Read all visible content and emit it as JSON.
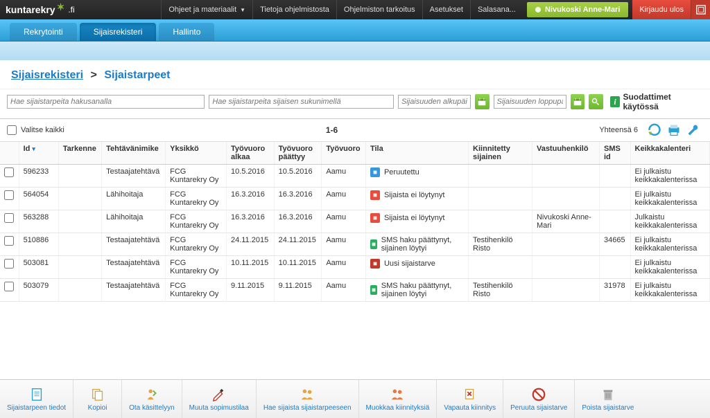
{
  "brand": {
    "name": "kuntarekry",
    "suffix": ".fi"
  },
  "topmenu": {
    "ohjeet": "Ohjeet ja materiaalit",
    "tietoja": "Tietoja ohjelmistosta",
    "tarkoitus": "Ohjelmiston tarkoitus",
    "asetukset": "Asetukset",
    "salasana": "Salasana..."
  },
  "user": {
    "name": "Nivukoski Anne-Mari"
  },
  "logout": "Kirjaudu ulos",
  "tabs": {
    "rekry": "Rekrytointi",
    "sijais": "Sijaisrekisteri",
    "hallinto": "Hallinto"
  },
  "breadcrumb": {
    "root": "Sijaisrekisteri",
    "sep": ">",
    "current": "Sijaistarpeet"
  },
  "search": {
    "ph1": "Hae sijaistarpeita hakusanalla",
    "ph2": "Hae sijaistarpeita sijaisen sukunimellä",
    "ph3": "Sijaisuuden alkupäivä",
    "ph4": "Sijaisuuden loppupäivä",
    "filters_label": "Suodattimet käytössä"
  },
  "listbar": {
    "select_all": "Valitse kaikki",
    "pager": "1-6",
    "total_label": "Yhteensä 6"
  },
  "columns": {
    "id": "Id",
    "tarkenne": "Tarkenne",
    "tehtavanimike": "Tehtävänimike",
    "yksikko": "Yksikkö",
    "alkaa": "Työvuoro alkaa",
    "paattyy": "Työvuoro päättyy",
    "tyovuoro": "Työvuoro",
    "tila": "Tila",
    "kiinnitetty": "Kiinnitetty sijainen",
    "vastuu": "Vastuuhenkilö",
    "smsid": "SMS id",
    "keikka": "Keikkakalenteri"
  },
  "rows": [
    {
      "id": "596233",
      "tarkenne": "",
      "tehtava": "Testaajatehtävä",
      "yksikko": "FCG Kuntarekry Oy",
      "alkaa": "10.5.2016",
      "paattyy": "10.5.2016",
      "vuoro": "Aamu",
      "tila_color": "blue",
      "tila": "Peruutettu",
      "kii": "",
      "vastuu": "",
      "sms": "",
      "keikka": "Ei julkaistu keikkakalenterissa"
    },
    {
      "id": "564054",
      "tarkenne": "",
      "tehtava": "Lähihoitaja",
      "yksikko": "FCG Kuntarekry Oy",
      "alkaa": "16.3.2016",
      "paattyy": "16.3.2016",
      "vuoro": "Aamu",
      "tila_color": "red",
      "tila": "Sijaista ei löytynyt",
      "kii": "",
      "vastuu": "",
      "sms": "",
      "keikka": "Ei julkaistu keikkakalenterissa"
    },
    {
      "id": "563288",
      "tarkenne": "",
      "tehtava": "Lähihoitaja",
      "yksikko": "FCG Kuntarekry Oy",
      "alkaa": "16.3.2016",
      "paattyy": "16.3.2016",
      "vuoro": "Aamu",
      "tila_color": "red",
      "tila": "Sijaista ei löytynyt",
      "kii": "",
      "vastuu": "Nivukoski Anne-Mari",
      "sms": "",
      "keikka": "Julkaistu keikkakalenterissa"
    },
    {
      "id": "510886",
      "tarkenne": "",
      "tehtava": "Testaajatehtävä",
      "yksikko": "FCG Kuntarekry Oy",
      "alkaa": "24.11.2015",
      "paattyy": "24.11.2015",
      "vuoro": "Aamu",
      "tila_color": "green",
      "tila": "SMS haku päättynyt, sijainen löytyi",
      "kii": "Testihenkilö Risto",
      "vastuu": "",
      "sms": "34665",
      "keikka": "Ei julkaistu keikkakalenterissa"
    },
    {
      "id": "503081",
      "tarkenne": "",
      "tehtava": "Testaajatehtävä",
      "yksikko": "FCG Kuntarekry Oy",
      "alkaa": "10.11.2015",
      "paattyy": "10.11.2015",
      "vuoro": "Aamu",
      "tila_color": "redd",
      "tila": "Uusi sijaistarve",
      "kii": "",
      "vastuu": "",
      "sms": "",
      "keikka": "Ei julkaistu keikkakalenterissa"
    },
    {
      "id": "503079",
      "tarkenne": "",
      "tehtava": "Testaajatehtävä",
      "yksikko": "FCG Kuntarekry Oy",
      "alkaa": "9.11.2015",
      "paattyy": "9.11.2015",
      "vuoro": "Aamu",
      "tila_color": "green",
      "tila": "SMS haku päättynyt, sijainen löytyi",
      "kii": "Testihenkilö Risto",
      "vastuu": "",
      "sms": "31978",
      "keikka": "Ei julkaistu keikkakalenterissa"
    }
  ],
  "actions": {
    "tiedot": "Sijaistarpeen tiedot",
    "kopioi": "Kopioi",
    "ota": "Ota käsittelyyn",
    "muuta": "Muuta sopimustilaa",
    "hae": "Hae sijaista sijaistarpeeseen",
    "muokkaa": "Muokkaa kiinnityksiä",
    "vapauta": "Vapauta kiinnitys",
    "peruuta": "Peruuta sijaistarve",
    "poista": "Poista sijaistarve"
  }
}
